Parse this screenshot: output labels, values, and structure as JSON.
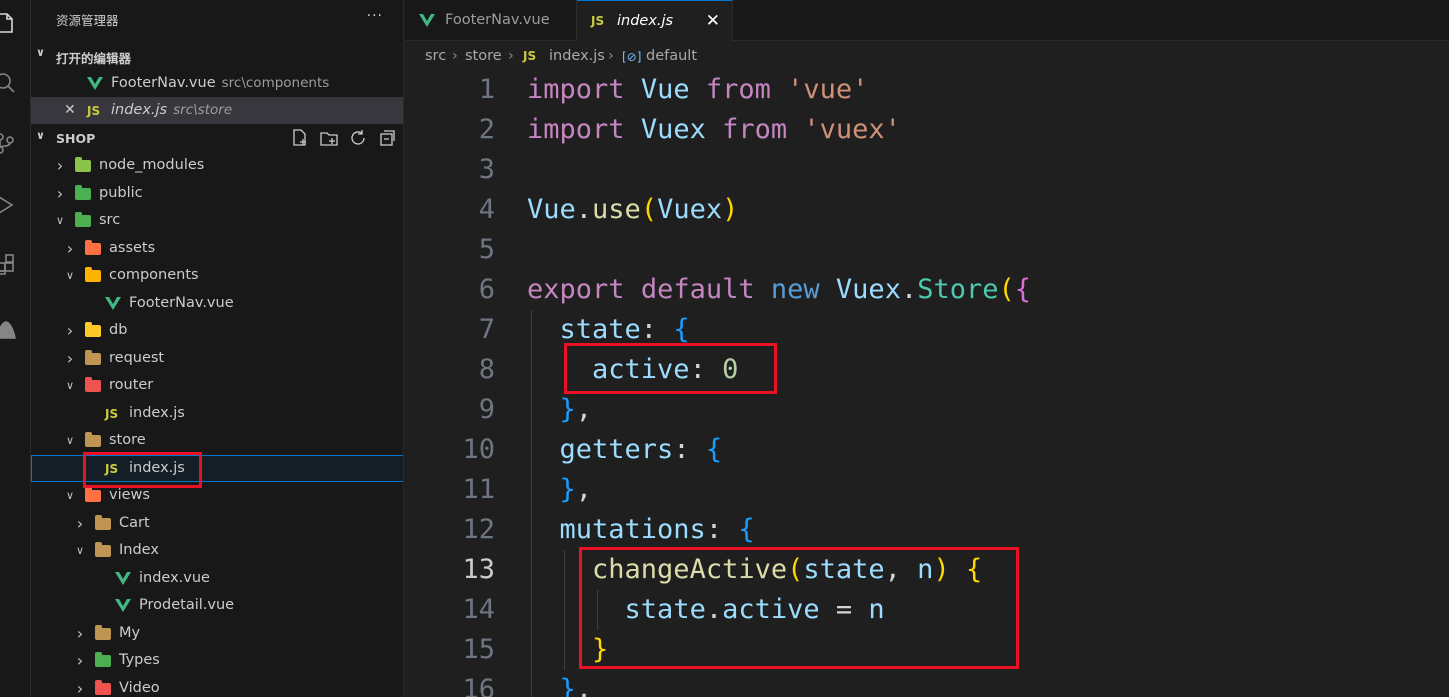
{
  "explorer": {
    "title": "资源管理器",
    "more": "···",
    "open_editors": {
      "label": "打开的编辑器",
      "items": [
        {
          "name": "FooterNav.vue",
          "desc": "src\\components",
          "icon": "vue-icon"
        },
        {
          "name": "index.js",
          "desc": "src\\store",
          "icon": "js-icon",
          "close": "✕"
        }
      ]
    },
    "project": {
      "label": "SHOP",
      "tree": [
        {
          "name": "node_modules",
          "type": "folder",
          "open": false,
          "depth": 1,
          "color": "#8bc34a"
        },
        {
          "name": "public",
          "type": "folder",
          "open": false,
          "depth": 1,
          "color": "#4caf50"
        },
        {
          "name": "src",
          "type": "folder",
          "open": true,
          "depth": 1,
          "color": "#4caf50"
        },
        {
          "name": "assets",
          "type": "folder",
          "open": false,
          "depth": 2,
          "color": "#ff7043"
        },
        {
          "name": "components",
          "type": "folder",
          "open": true,
          "depth": 2,
          "color": "#ffb300"
        },
        {
          "name": "FooterNav.vue",
          "type": "vue",
          "depth": 3
        },
        {
          "name": "db",
          "type": "folder",
          "open": false,
          "depth": 2,
          "color": "#ffca28"
        },
        {
          "name": "request",
          "type": "folder",
          "open": false,
          "depth": 2,
          "color": "#c09553"
        },
        {
          "name": "router",
          "type": "folder",
          "open": true,
          "depth": 2,
          "color": "#ef5350"
        },
        {
          "name": "index.js",
          "type": "js",
          "depth": 3
        },
        {
          "name": "store",
          "type": "folder",
          "open": true,
          "depth": 2,
          "color": "#c09553"
        },
        {
          "name": "index.js",
          "type": "js",
          "depth": 3,
          "focused": true
        },
        {
          "name": "views",
          "type": "folder",
          "open": true,
          "depth": 2,
          "color": "#ff7043"
        },
        {
          "name": "Cart",
          "type": "folder",
          "open": false,
          "depth": 3,
          "color": "#c09553"
        },
        {
          "name": "Index",
          "type": "folder",
          "open": true,
          "depth": 3,
          "color": "#c09553"
        },
        {
          "name": "index.vue",
          "type": "vue",
          "depth": 4
        },
        {
          "name": "Prodetail.vue",
          "type": "vue",
          "depth": 4
        },
        {
          "name": "My",
          "type": "folder",
          "open": false,
          "depth": 3,
          "color": "#c09553"
        },
        {
          "name": "Types",
          "type": "folder",
          "open": false,
          "depth": 3,
          "color": "#4caf50"
        },
        {
          "name": "Video",
          "type": "folder",
          "open": false,
          "depth": 3,
          "color": "#ef5350"
        }
      ]
    }
  },
  "tabs": [
    {
      "name": "FooterNav.vue",
      "icon": "vue-icon",
      "active": false
    },
    {
      "name": "index.js",
      "icon": "js-icon",
      "active": true,
      "close": "✕"
    }
  ],
  "breadcrumb": [
    "src",
    "store",
    "index.js",
    "default"
  ],
  "editor": {
    "current_line": 13,
    "lines": [
      {
        "n": "1",
        "tokens": [
          [
            "kw",
            "import"
          ],
          [
            "p",
            " "
          ],
          [
            "id",
            "Vue"
          ],
          [
            "p",
            " "
          ],
          [
            "kw",
            "from"
          ],
          [
            "p",
            " "
          ],
          [
            "str",
            "'vue'"
          ]
        ]
      },
      {
        "n": "2",
        "tokens": [
          [
            "kw",
            "import"
          ],
          [
            "p",
            " "
          ],
          [
            "id",
            "Vuex"
          ],
          [
            "p",
            " "
          ],
          [
            "kw",
            "from"
          ],
          [
            "p",
            " "
          ],
          [
            "str",
            "'vuex'"
          ]
        ]
      },
      {
        "n": "3",
        "tokens": []
      },
      {
        "n": "4",
        "tokens": [
          [
            "id",
            "Vue"
          ],
          [
            "p",
            "."
          ],
          [
            "fn",
            "use"
          ],
          [
            "b1",
            "("
          ],
          [
            "id",
            "Vuex"
          ],
          [
            "b1",
            ")"
          ]
        ]
      },
      {
        "n": "5",
        "tokens": []
      },
      {
        "n": "6",
        "tokens": [
          [
            "kw",
            "export"
          ],
          [
            "p",
            " "
          ],
          [
            "kw",
            "default"
          ],
          [
            "p",
            " "
          ],
          [
            "kb",
            "new"
          ],
          [
            "p",
            " "
          ],
          [
            "id",
            "Vuex"
          ],
          [
            "p",
            "."
          ],
          [
            "cls",
            "Store"
          ],
          [
            "b1",
            "("
          ],
          [
            "b2",
            "{"
          ]
        ]
      },
      {
        "n": "7",
        "tokens": [
          [
            "p",
            "  "
          ],
          [
            "id",
            "state"
          ],
          [
            "p",
            ": "
          ],
          [
            "b3",
            "{"
          ]
        ]
      },
      {
        "n": "8",
        "tokens": [
          [
            "p",
            "    "
          ],
          [
            "id",
            "active"
          ],
          [
            "p",
            ": "
          ],
          [
            "num",
            "0"
          ]
        ]
      },
      {
        "n": "9",
        "tokens": [
          [
            "p",
            "  "
          ],
          [
            "b3",
            "}"
          ],
          [
            "p",
            ","
          ]
        ]
      },
      {
        "n": "10",
        "tokens": [
          [
            "p",
            "  "
          ],
          [
            "id",
            "getters"
          ],
          [
            "p",
            ": "
          ],
          [
            "b3",
            "{"
          ]
        ]
      },
      {
        "n": "11",
        "tokens": [
          [
            "p",
            "  "
          ],
          [
            "b3",
            "}"
          ],
          [
            "p",
            ","
          ]
        ]
      },
      {
        "n": "12",
        "tokens": [
          [
            "p",
            "  "
          ],
          [
            "id",
            "mutations"
          ],
          [
            "p",
            ": "
          ],
          [
            "b3",
            "{"
          ]
        ]
      },
      {
        "n": "13",
        "tokens": [
          [
            "p",
            "    "
          ],
          [
            "fn",
            "changeActive"
          ],
          [
            "b1",
            "("
          ],
          [
            "id",
            "state"
          ],
          [
            "p",
            ", "
          ],
          [
            "id",
            "n"
          ],
          [
            "b1",
            ")"
          ],
          [
            "p",
            " "
          ],
          [
            "b1",
            "{"
          ]
        ]
      },
      {
        "n": "14",
        "tokens": [
          [
            "p",
            "      "
          ],
          [
            "id",
            "state"
          ],
          [
            "p",
            "."
          ],
          [
            "id",
            "active"
          ],
          [
            "p",
            " = "
          ],
          [
            "id",
            "n"
          ]
        ]
      },
      {
        "n": "15",
        "tokens": [
          [
            "p",
            "    "
          ],
          [
            "b1",
            "}"
          ]
        ]
      },
      {
        "n": "16",
        "tokens": [
          [
            "p",
            "  "
          ],
          [
            "b3",
            "}"
          ],
          [
            "p",
            ","
          ]
        ]
      }
    ]
  },
  "colors": {
    "annotation": "#e81224",
    "accent": "#0078d4"
  }
}
